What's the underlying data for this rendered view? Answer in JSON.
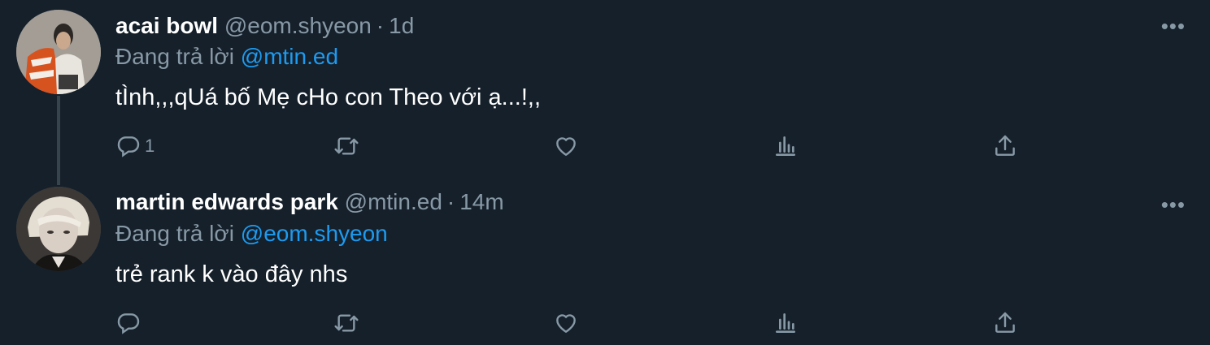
{
  "tweets": [
    {
      "name": "acai bowl",
      "handle": "@eom.shyeon",
      "dot": "·",
      "time": "1d",
      "replying_prefix": "Đang trả lời",
      "replying_to": "@mtin.ed",
      "text": "tÌnh,,,qUá bố Mẹ cHo con Theo với ạ...!,,",
      "more": "•••",
      "reply_count": "1",
      "retweet_count": "",
      "like_count": ""
    },
    {
      "name": "martin edwards park",
      "handle": "@mtin.ed",
      "dot": "·",
      "time": "14m",
      "replying_prefix": "Đang trả lời",
      "replying_to": "@eom.shyeon",
      "text": "trẻ rank k vào đây nhs",
      "more": "•••",
      "reply_count": "",
      "retweet_count": "",
      "like_count": ""
    }
  ],
  "colors": {
    "background": "#15202b",
    "secondary_text": "#8899a6",
    "accent": "#1d9bf0",
    "thread_line": "#38444d"
  },
  "icons": [
    "reply-icon",
    "retweet-icon",
    "like-icon",
    "analytics-icon",
    "share-icon",
    "more-icon"
  ]
}
